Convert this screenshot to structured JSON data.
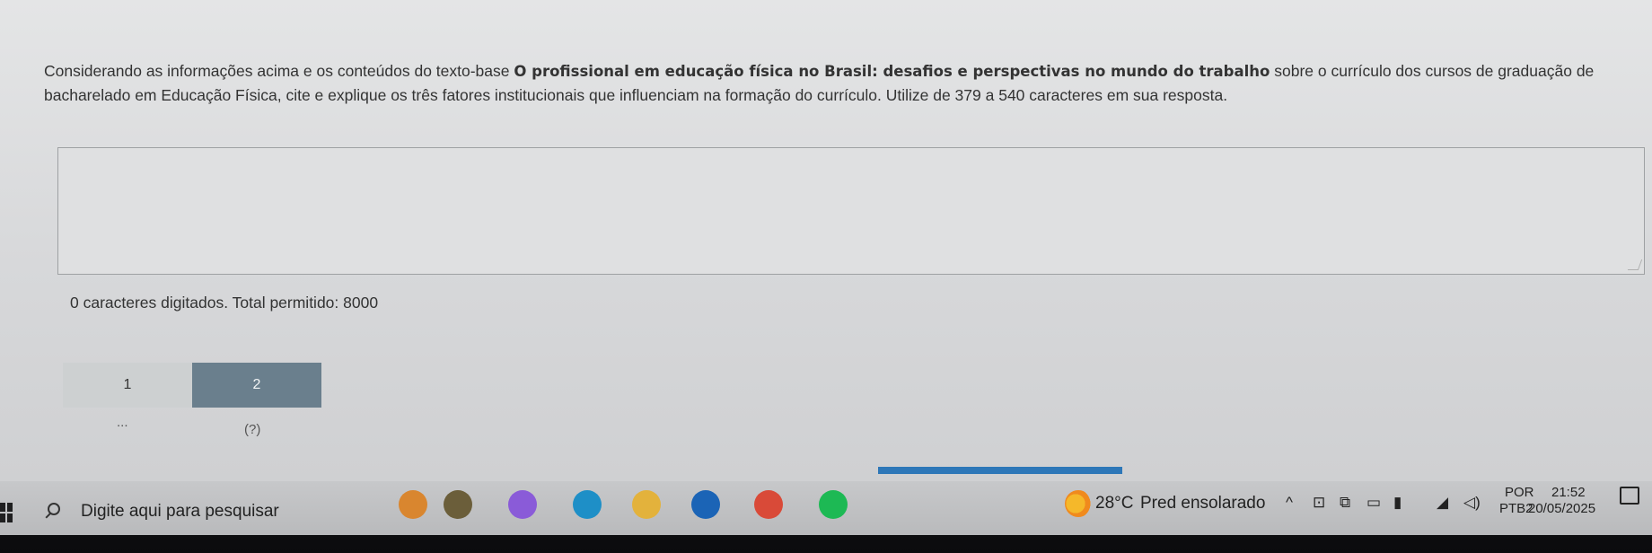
{
  "question": {
    "part1": "Considerando as informações acima e os conteúdos do texto-base ",
    "bold": "O profissional em educação física no Brasil: desafios e perspectivas no mundo do trabalho",
    "part2": " sobre o currículo dos cursos de graduação de bacharelado em Educação Física, cite e explique os três fatores institucionais que influenciam na formação do currículo. Utilize de 379 a 540 caracteres em sua resposta."
  },
  "answer": {
    "value": "",
    "placeholder": ""
  },
  "char_count": "0 caracteres digitados. Total permitido: 8000",
  "pager": {
    "pages": [
      "1",
      "2"
    ],
    "current": "2",
    "more": "...",
    "help": "(?)"
  },
  "taskbar": {
    "search_placeholder": "Digite aqui para pesquisar",
    "weather_temp": "28°C",
    "weather_desc": "Pred ensolarado",
    "lang_top": "POR",
    "lang_bottom": "PTB2",
    "time": "21:52",
    "date": "20/05/2025",
    "apps": [
      {
        "name": "flower-widget-icon",
        "color": "#d9862f"
      },
      {
        "name": "bee-app-icon",
        "color": "#6b5e3a"
      },
      {
        "name": "copilot-icon",
        "color": "#8a5bd8"
      },
      {
        "name": "edge-icon",
        "color": "#1e8fc7"
      },
      {
        "name": "file-explorer-icon",
        "color": "#e3b23c"
      },
      {
        "name": "outlook-icon",
        "color": "#1b64b6"
      },
      {
        "name": "chrome-icon",
        "color": "#d94a38"
      },
      {
        "name": "spotify-icon",
        "color": "#1db954"
      }
    ],
    "accent": "#2d77b8"
  }
}
